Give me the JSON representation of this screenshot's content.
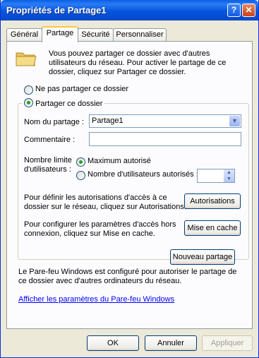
{
  "window": {
    "title": "Propriétés de Partage1",
    "help_label": "?",
    "close_label": "✕"
  },
  "tabs": [
    "Général",
    "Partage",
    "Sécurité",
    "Personnaliser"
  ],
  "sharing": {
    "intro": "Vous pouvez partager ce dossier avec d'autres utilisateurs du réseau. Pour activer le partage de ce dossier, cliquez sur Partager ce dossier.",
    "option_no_share": "Ne pas partager ce dossier",
    "option_share": "Partager ce dossier",
    "share_name_label": "Nom du partage :",
    "share_name_value": "Partage1",
    "comment_label": "Commentaire :",
    "comment_value": "",
    "user_limit_label": "Nombre limite d'utilisateurs :",
    "user_limit_max": "Maximum autorisé",
    "user_limit_count": "Nombre d'utilisateurs autorisés :",
    "user_limit_value": "",
    "permissions_text": "Pour définir les autorisations d'accès à ce dossier sur le réseau, cliquez sur Autorisations.",
    "permissions_button": "Autorisations",
    "caching_text": "Pour configurer les paramètres d'accès hors connexion, cliquez sur Mise en cache.",
    "caching_button": "Mise en cache",
    "new_share_button": "Nouveau partage",
    "firewall_text": "Le Pare-feu Windows est configuré pour autoriser le partage de ce dossier avec d'autres ordinateurs du réseau.",
    "firewall_link": "Afficher les paramètres du Pare-feu Windows"
  },
  "footer": {
    "ok": "OK",
    "cancel": "Annuler",
    "apply": "Appliquer"
  },
  "colors": {
    "title_bar": "#0555dd",
    "accent_tab": "#ffc83c",
    "radio_dot": "#21a121",
    "link": "#0000ff"
  }
}
